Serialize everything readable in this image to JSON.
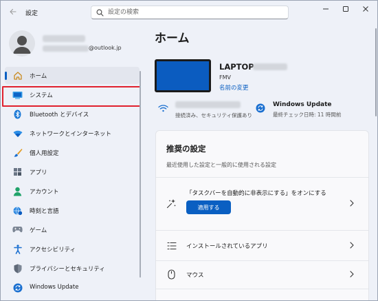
{
  "app": {
    "title": "設定"
  },
  "search": {
    "placeholder": "設定の検索"
  },
  "profile": {
    "email_suffix": "@outlook.jp"
  },
  "sidebar": {
    "items": [
      {
        "label": "ホーム",
        "icon": "home-icon"
      },
      {
        "label": "システム",
        "icon": "display-icon"
      },
      {
        "label": "Bluetooth とデバイス",
        "icon": "bluetooth-icon"
      },
      {
        "label": "ネットワークとインターネット",
        "icon": "wifi-icon"
      },
      {
        "label": "個人用設定",
        "icon": "brush-icon"
      },
      {
        "label": "アプリ",
        "icon": "apps-icon"
      },
      {
        "label": "アカウント",
        "icon": "account-icon"
      },
      {
        "label": "時刻と言語",
        "icon": "globe-clock-icon"
      },
      {
        "label": "ゲーム",
        "icon": "gamepad-icon"
      },
      {
        "label": "アクセシビリティ",
        "icon": "accessibility-icon"
      },
      {
        "label": "プライバシーとセキュリティ",
        "icon": "shield-icon"
      },
      {
        "label": "Windows Update",
        "icon": "update-icon"
      }
    ]
  },
  "main": {
    "title": "ホーム",
    "device": {
      "name_prefix": "LAPTOP-",
      "brand": "FMV",
      "rename_link": "名前の変更"
    },
    "network": {
      "status": "接続済み、セキュリティ保護あり"
    },
    "windows_update": {
      "title": "Windows Update",
      "status": "最終チェック日時: 11 時間前"
    },
    "recommended": {
      "title": "推奨の設定",
      "subtitle": "最近使用した設定と一般的に使用される設定",
      "rows": [
        {
          "label": "「タスクバーを自動的に非表示にする」をオンにする",
          "button": "適用する"
        },
        {
          "label": "インストールされているアプリ"
        },
        {
          "label": "マウス"
        }
      ]
    }
  },
  "colors": {
    "accent": "#0a5fc2",
    "highlight": "#e0202d",
    "window_bg": "#eef1f8",
    "card_bg": "#f9f9fb"
  }
}
